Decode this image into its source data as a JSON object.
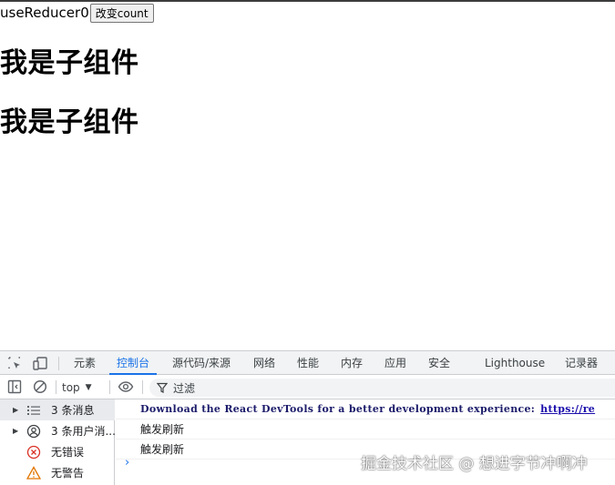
{
  "page": {
    "text": "useReducer0",
    "button_label": "改变count",
    "headings": [
      "我是子组件",
      "我是子组件"
    ]
  },
  "devtools": {
    "tabs": [
      {
        "label": "元素",
        "active": false
      },
      {
        "label": "控制台",
        "active": true
      },
      {
        "label": "源代码/来源",
        "active": false
      },
      {
        "label": "网络",
        "active": false
      },
      {
        "label": "性能",
        "active": false
      },
      {
        "label": "内存",
        "active": false
      },
      {
        "label": "应用",
        "active": false
      },
      {
        "label": "安全",
        "active": false
      },
      {
        "label": "Lighthouse",
        "active": false
      },
      {
        "label": "记录器",
        "active": false
      }
    ],
    "toolbar": {
      "context": "top",
      "filter_placeholder": "过滤"
    },
    "sidebar": [
      {
        "label": "3 条消息",
        "icon": "list-icon",
        "selected": true
      },
      {
        "label": "3 条用户消...",
        "icon": "user-icon",
        "selected": false
      },
      {
        "label": "无错误",
        "icon": "error-icon",
        "selected": false
      },
      {
        "label": "无警告",
        "icon": "warning-icon",
        "selected": false
      }
    ],
    "console": {
      "messages": [
        {
          "text": "Download the React DevTools for a better development experience:",
          "link": "https://re"
        },
        {
          "text": "触发刷新"
        },
        {
          "text": "触发刷新"
        }
      ]
    }
  },
  "watermark": "掘金技术社区 @ 想进字节冲啊冲",
  "colors": {
    "accent": "#1a73e8",
    "error": "#d93025",
    "warning": "#e37400"
  }
}
